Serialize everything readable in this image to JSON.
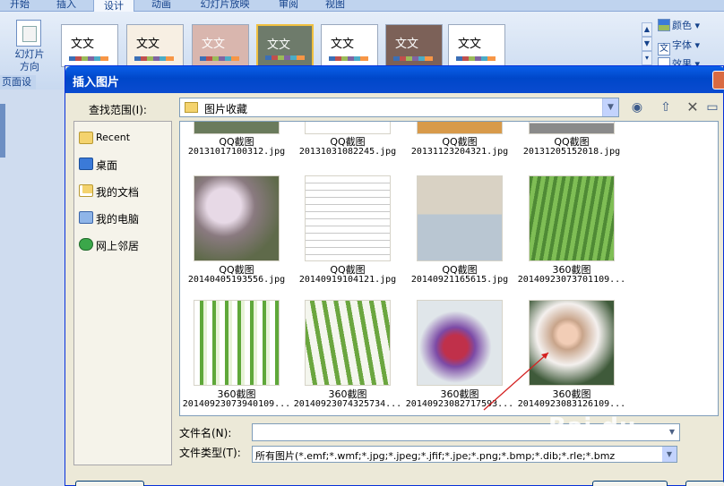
{
  "ribbon": {
    "tabs": [
      "开始",
      "插入",
      "设计",
      "动画",
      "幻灯片放映",
      "审阅",
      "视图"
    ],
    "active_tab": "设计",
    "slide_orientation_label": "幻灯片\n方向",
    "group_label": "页面设置",
    "theme_text": "文文",
    "theme_text_alt": "文文",
    "colors_button": "颜色",
    "fonts_button": "字体",
    "effects_button": "效果",
    "theme_colors": [
      "#ffffff",
      "#f7efe3",
      "#d9b6ae",
      "#6e7b6b",
      "#ffffff",
      "#7c6158",
      "#ffffff"
    ]
  },
  "dialog": {
    "title": "插入图片",
    "lookin_label": "查找范围(I):",
    "lookin_value": "图片收藏",
    "places": [
      {
        "label": "Recent",
        "icon": "recent-folder-icon"
      },
      {
        "label": "桌面",
        "icon": "desktop-icon"
      },
      {
        "label": "我的文档",
        "icon": "my-documents-icon"
      },
      {
        "label": "我的电脑",
        "icon": "my-computer-icon"
      },
      {
        "label": "网上邻居",
        "icon": "network-icon"
      }
    ],
    "files": [
      {
        "title": "QQ截图",
        "name": "20131017100312.jpg"
      },
      {
        "title": "QQ截图",
        "name": "20131031082245.jpg"
      },
      {
        "title": "QQ截图",
        "name": "20131123204321.jpg"
      },
      {
        "title": "QQ截图",
        "name": "20131205152018.jpg"
      },
      {
        "title": "QQ截图",
        "name": "20140405193556.jpg"
      },
      {
        "title": "QQ截图",
        "name": "20140919104121.jpg"
      },
      {
        "title": "QQ截图",
        "name": "20140921165615.jpg"
      },
      {
        "title": "360截图",
        "name": "20140923073701109..."
      },
      {
        "title": "360截图",
        "name": "20140923073940109..."
      },
      {
        "title": "360截图",
        "name": "20140923074325734..."
      },
      {
        "title": "360截图",
        "name": "20140923082717593..."
      },
      {
        "title": "360截图",
        "name": "20140923083126109..."
      }
    ],
    "filename_label": "文件名(N):",
    "filename_value": "",
    "filetype_label": "文件类型(T):",
    "filetype_value": "所有图片(*.emf;*.wmf;*.jpg;*.jpeg;*.jfif;*.jpe;*.png;*.bmp;*.dib;*.rle;*.bmz"
  },
  "watermark": "Bai du"
}
